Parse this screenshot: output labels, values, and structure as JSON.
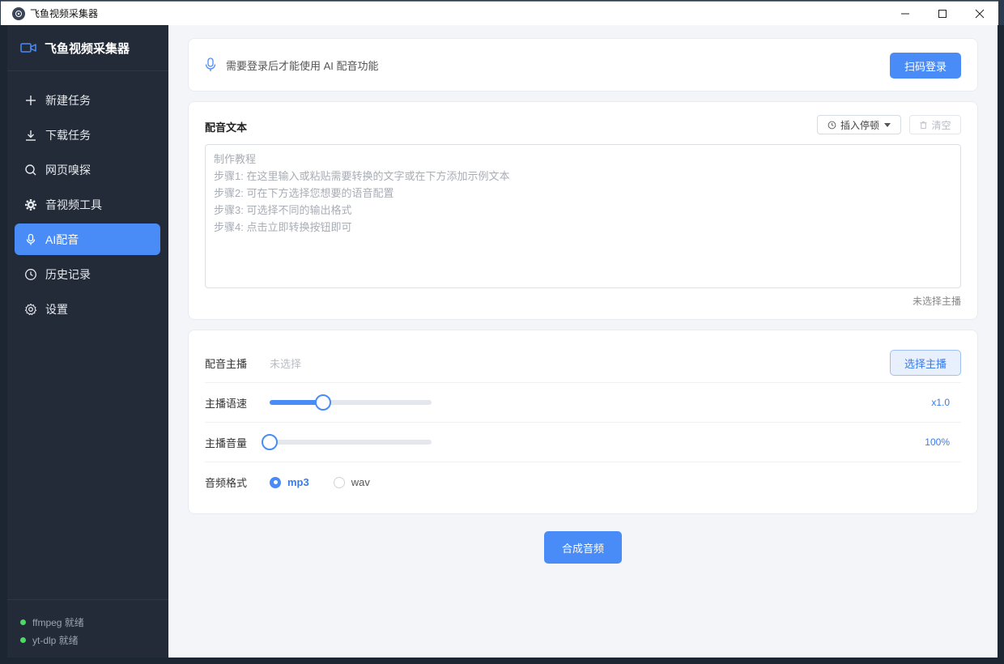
{
  "window": {
    "title": "飞鱼视频采集器"
  },
  "sidebar": {
    "brand": "飞鱼视频采集器",
    "items": [
      {
        "label": "新建任务",
        "icon": "plus-icon"
      },
      {
        "label": "下载任务",
        "icon": "download-icon"
      },
      {
        "label": "网页嗅探",
        "icon": "search-icon"
      },
      {
        "label": "音视频工具",
        "icon": "gear-icon"
      },
      {
        "label": "AI配音",
        "icon": "microphone-icon",
        "active": true
      },
      {
        "label": "历史记录",
        "icon": "clock-icon"
      },
      {
        "label": "设置",
        "icon": "settings-icon"
      }
    ],
    "status": [
      {
        "label": "ffmpeg 就绪",
        "color": "#4cd964"
      },
      {
        "label": "yt-dlp 就绪",
        "color": "#4cd964"
      }
    ]
  },
  "login": {
    "message": "需要登录后才能使用 AI 配音功能",
    "button": "扫码登录"
  },
  "dubbing_text": {
    "title": "配音文本",
    "insert_pause": "插入停顿",
    "clear": "清空",
    "placeholder": "制作教程\n  步骤1: 在这里输入或粘贴需要转换的文字或在下方添加示例文本\n  步骤2: 可在下方选择您想要的语音配置\n  步骤3: 可选择不同的输出格式\n  步骤4: 点击立即转换按钮即可",
    "anchor_note": "未选择主播"
  },
  "config": {
    "anchor": {
      "label": "配音主播",
      "value": "未选择",
      "button": "选择主播"
    },
    "speed": {
      "label": "主播语速",
      "readout": "x1.0",
      "fraction": 0.33
    },
    "volume": {
      "label": "主播音量",
      "readout": "100%",
      "fraction": 0.0
    },
    "format": {
      "label": "音频格式",
      "options": [
        "mp3",
        "wav"
      ],
      "selected": "mp3"
    }
  },
  "synthesize_button": "合成音频",
  "colors": {
    "accent": "#4a8cf7",
    "sidebar_bg": "#232b38",
    "ready": "#4cd964"
  }
}
